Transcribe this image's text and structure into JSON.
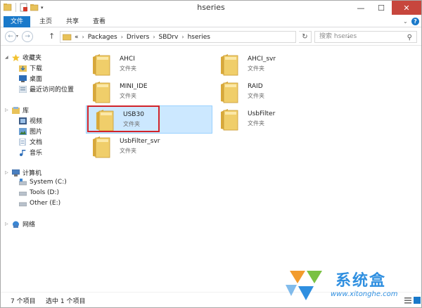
{
  "window": {
    "title": "hseries"
  },
  "ribbon": {
    "tabs": [
      "文件",
      "主页",
      "共享",
      "查看"
    ]
  },
  "address": {
    "prefix": "«",
    "crumbs": [
      "Packages",
      "Drivers",
      "SBDrv",
      "hseries"
    ],
    "search_placeholder": "搜索 hseries"
  },
  "nav": {
    "favorites": {
      "label": "收藏夹",
      "items": [
        "下载",
        "桌面",
        "最近访问的位置"
      ]
    },
    "libraries": {
      "label": "库",
      "items": [
        "视频",
        "图片",
        "文档",
        "音乐"
      ]
    },
    "computer": {
      "label": "计算机",
      "items": [
        "System (C:)",
        "Tools (D:)",
        "Other (E:)"
      ]
    },
    "network": {
      "label": "网络"
    }
  },
  "files": [
    {
      "name": "AHCI",
      "type": "文件夹"
    },
    {
      "name": "AHCI_svr",
      "type": "文件夹"
    },
    {
      "name": "MINI_IDE",
      "type": "文件夹"
    },
    {
      "name": "RAID",
      "type": "文件夹"
    },
    {
      "name": "USB30",
      "type": "文件夹",
      "selected": true
    },
    {
      "name": "UsbFilter",
      "type": "文件夹"
    },
    {
      "name": "UsbFilter_svr",
      "type": "文件夹"
    }
  ],
  "status": {
    "count": "7 个项目",
    "selection": "选中 1 个项目"
  },
  "watermark": {
    "brand": "系统盒",
    "url": "www.xitonghe.com"
  },
  "colors": {
    "accent": "#1979ca",
    "folder": "#e8c25a",
    "selection": "#cce8ff",
    "highlight": "#d1232a"
  }
}
